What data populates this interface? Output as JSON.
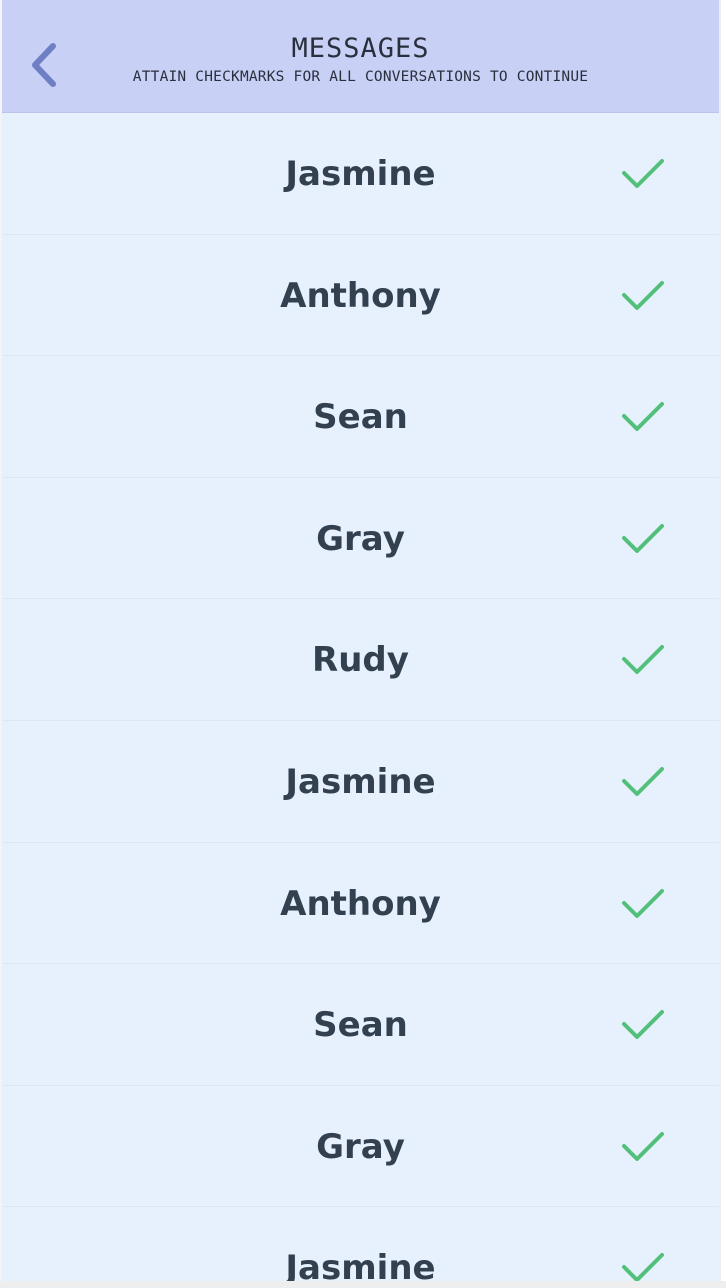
{
  "header": {
    "title": "MESSAGES",
    "subtitle": "ATTAIN CHECKMARKS FOR ALL CONVERSATIONS TO CONTINUE",
    "back_icon": "chevron-left-icon"
  },
  "conversations": [
    {
      "name": "Jasmine",
      "completed": true
    },
    {
      "name": "Anthony",
      "completed": true
    },
    {
      "name": "Sean",
      "completed": true
    },
    {
      "name": "Gray",
      "completed": true
    },
    {
      "name": "Rudy",
      "completed": true
    },
    {
      "name": "Jasmine",
      "completed": true
    },
    {
      "name": "Anthony",
      "completed": true
    },
    {
      "name": "Sean",
      "completed": true
    },
    {
      "name": "Gray",
      "completed": true
    },
    {
      "name": "Jasmine",
      "completed": true
    }
  ],
  "colors": {
    "header_background": "#c8d0f5",
    "list_background": "#e6f1fd",
    "back_icon": "#6e7fc4",
    "checkmark": "#52c07a",
    "name_text": "#33404f"
  }
}
